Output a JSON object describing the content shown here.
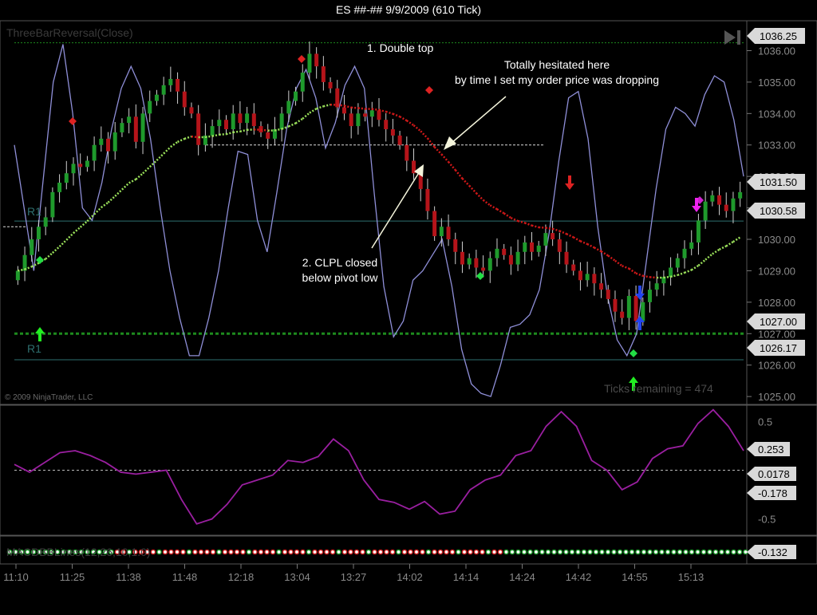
{
  "window_title": "ES ##-##  9/9/2009 (610 Tick)",
  "colors": {
    "background": "#000000",
    "up_bar": "#1f9a2c",
    "down_bar": "#b5141a",
    "stochastic": "#8f8fd8",
    "ema": "#9ae05a",
    "ema_down": "#d01818",
    "cci": "#9a1fa0",
    "pivot": "#2e6f6f",
    "support": "#1d8a1d",
    "price_label_bg": "#d9d9d9"
  },
  "price_panel": {
    "indicator_label": "ThreeBarReversal(Close)",
    "copyright": "© 2009 NinjaTrader, LLC",
    "ticks_remaining": "Ticks remaining = 474",
    "pivot_labels": [
      "R1",
      "R1"
    ],
    "annotations": [
      "1. Double top",
      "Totally hesitated here",
      "by time I set my order price was dropping",
      "2. CLPL closed",
      "below pivot low"
    ],
    "price_labels": [
      "1036.25",
      "1031.50",
      "1030.58",
      "1027.00",
      "1026.17"
    ],
    "y_ticks": [
      "1036.00",
      "1035.00",
      "1034.00",
      "1033.00",
      "1032.00",
      "1031.00",
      "1030.00",
      "1029.00",
      "1028.00",
      "1027.00",
      "1026.00",
      "1025.00"
    ]
  },
  "indicator_panel": {
    "y_ticks": [
      "0.5",
      "0",
      "-0.5"
    ],
    "value_labels": [
      "0.253",
      "0.0178",
      "-0.178"
    ]
  },
  "bottom_panel": {
    "label": "MACDBBLines(12,26,10,1.0)",
    "value_label": "-0.132"
  },
  "x_ticks": [
    "11:10",
    "11:25",
    "11:38",
    "11:48",
    "12:18",
    "13:04",
    "13:27",
    "14:02",
    "14:14",
    "14:24",
    "14:42",
    "14:55",
    "15:13"
  ],
  "chart_data": {
    "type": "candlestick",
    "instrument": "ES ##-##",
    "date": "9/9/2009",
    "bar_period": "610 Tick",
    "ylim": [
      1024.8,
      1036.9
    ],
    "closes": [
      1029.0,
      1029.5,
      1030.0,
      1030.4,
      1030.7,
      1031.5,
      1031.8,
      1032.1,
      1032.4,
      1032.3,
      1032.5,
      1033.0,
      1033.2,
      1032.8,
      1033.4,
      1033.7,
      1033.9,
      1033.1,
      1034.0,
      1034.4,
      1034.6,
      1034.9,
      1035.1,
      1034.7,
      1034.2,
      1034.0,
      1033.0,
      1033.3,
      1033.6,
      1033.8,
      1033.5,
      1034.0,
      1033.7,
      1034.0,
      1033.6,
      1033.4,
      1033.2,
      1033.5,
      1034.0,
      1034.4,
      1034.7,
      1035.3,
      1035.9,
      1035.5,
      1035.0,
      1034.8,
      1034.2,
      1034.0,
      1033.6,
      1034.0,
      1033.9,
      1034.1,
      1033.8,
      1033.5,
      1033.3,
      1033.0,
      1032.5,
      1032.1,
      1031.6,
      1030.9,
      1030.1,
      1030.4,
      1030.0,
      1029.6,
      1029.2,
      1029.4,
      1029.1,
      1029.0,
      1029.4,
      1029.7,
      1029.5,
      1029.2,
      1029.6,
      1029.9,
      1029.6,
      1029.8,
      1030.2,
      1030.0,
      1029.6,
      1029.2,
      1029.0,
      1028.7,
      1028.9,
      1028.6,
      1028.4,
      1028.1,
      1027.7,
      1027.5,
      1028.2,
      1027.4,
      1028.0,
      1028.4,
      1028.6,
      1028.8,
      1029.1,
      1029.4,
      1029.7,
      1029.9,
      1030.6,
      1031.2,
      1031.4,
      1031.1,
      1030.9,
      1031.3,
      1031.5
    ],
    "stochastic": [
      1033.0,
      1031.0,
      1029.0,
      1032.0,
      1035.0,
      1036.2,
      1034.0,
      1031.0,
      1030.6,
      1031.8,
      1033.5,
      1034.8,
      1035.5,
      1034.8,
      1033.2,
      1031.0,
      1029.0,
      1027.5,
      1026.3,
      1026.3,
      1027.5,
      1029.0,
      1031.0,
      1032.8,
      1032.7,
      1030.6,
      1029.6,
      1031.5,
      1033.5,
      1034.8,
      1035.4,
      1034.5,
      1032.9,
      1033.7,
      1034.9,
      1035.5,
      1034.8,
      1031.5,
      1028.5,
      1026.9,
      1027.4,
      1028.7,
      1029.0,
      1029.5,
      1030.0,
      1028.5,
      1026.5,
      1025.4,
      1025.1,
      1025.0,
      1026.0,
      1027.2,
      1027.3,
      1027.6,
      1028.4,
      1030.2,
      1032.5,
      1034.5,
      1034.7,
      1033.2,
      1030.4,
      1028.2,
      1026.8,
      1026.3,
      1027.0,
      1029.3,
      1031.6,
      1033.5,
      1034.2,
      1034.0,
      1033.6,
      1034.6,
      1035.2,
      1035.0,
      1033.8,
      1032.0
    ],
    "cci": [
      0.06,
      -0.02,
      0.08,
      0.18,
      0.2,
      0.15,
      0.08,
      -0.02,
      -0.04,
      -0.02,
      0.0,
      -0.3,
      -0.55,
      -0.5,
      -0.35,
      -0.15,
      -0.1,
      -0.05,
      0.1,
      0.08,
      0.14,
      0.32,
      0.2,
      -0.1,
      -0.3,
      -0.33,
      -0.4,
      -0.32,
      -0.45,
      -0.42,
      -0.2,
      -0.1,
      -0.05,
      0.15,
      0.2,
      0.45,
      0.6,
      0.45,
      0.1,
      0.0,
      -0.2,
      -0.12,
      0.12,
      0.22,
      0.25,
      0.48,
      0.62,
      0.45,
      0.2
    ]
  }
}
